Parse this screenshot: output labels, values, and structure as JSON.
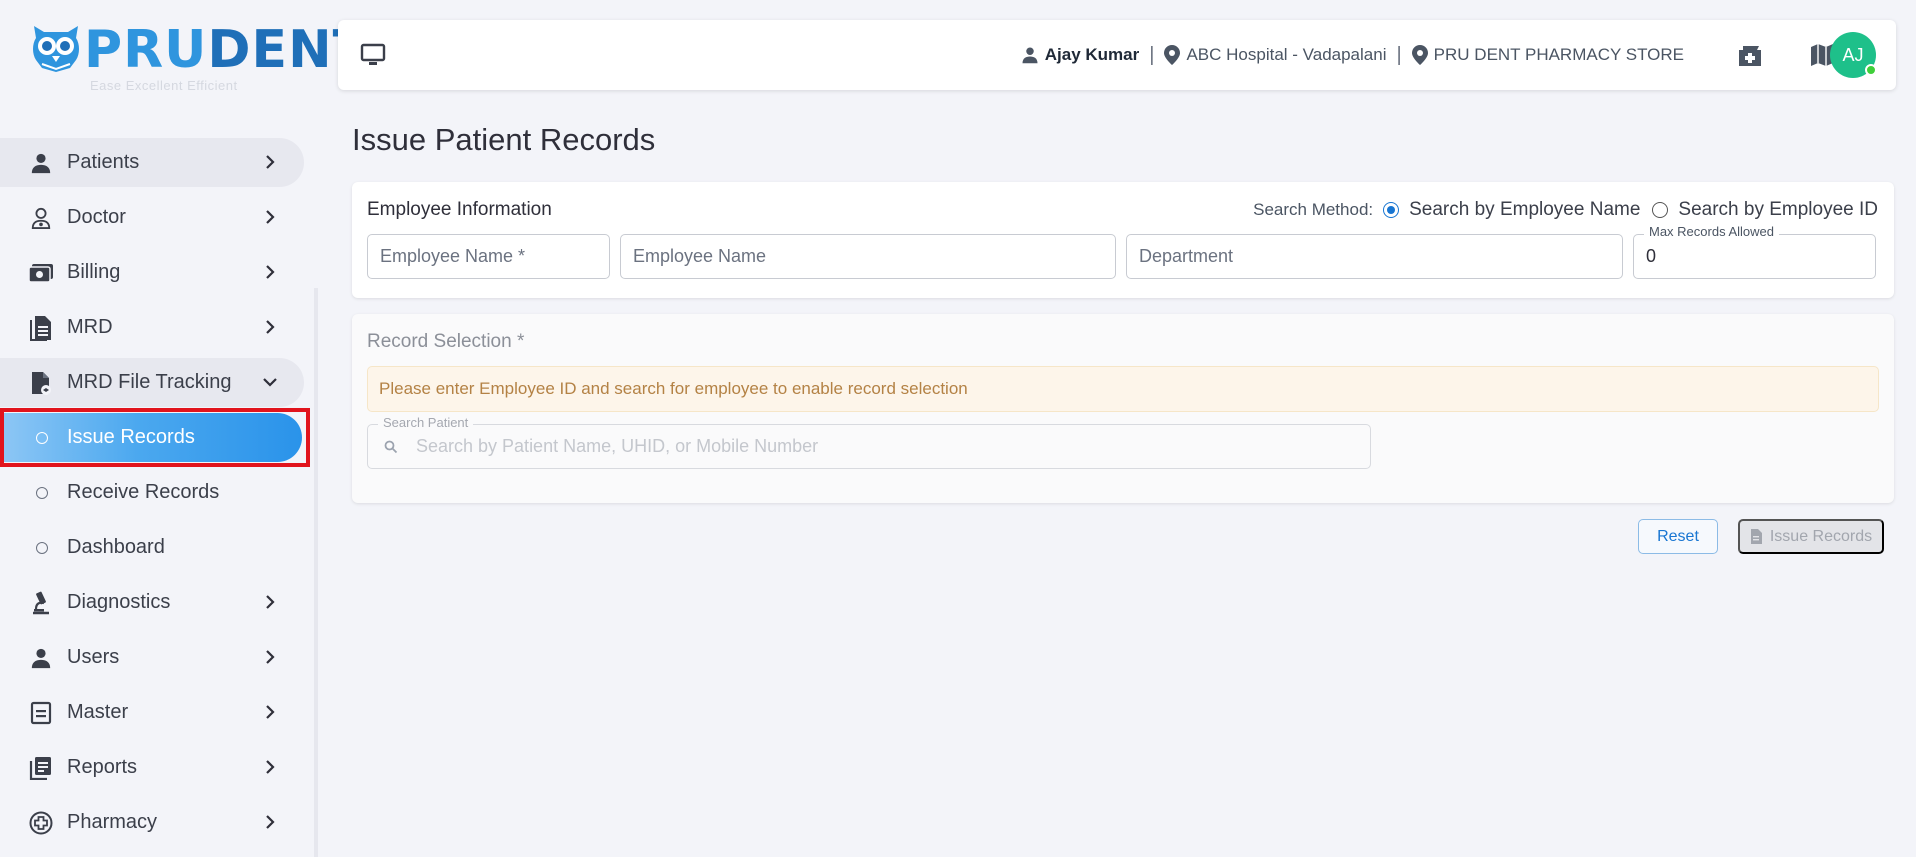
{
  "brand": {
    "name_part1": "PRU",
    "name_part2": "DENT",
    "tagline": "Ease Excellent Efficient"
  },
  "sidebar": {
    "items": [
      {
        "label": "Patients",
        "icon": "person-icon"
      },
      {
        "label": "Doctor",
        "icon": "doctor-icon"
      },
      {
        "label": "Billing",
        "icon": "billing-icon"
      },
      {
        "label": "MRD",
        "icon": "document-icon"
      },
      {
        "label": "MRD File Tracking",
        "icon": "file-tracking-icon",
        "expanded": true,
        "children": [
          {
            "label": "Issue Records",
            "active": true
          },
          {
            "label": "Receive Records"
          },
          {
            "label": "Dashboard"
          }
        ]
      },
      {
        "label": "Diagnostics",
        "icon": "microscope-icon"
      },
      {
        "label": "Users",
        "icon": "person-icon"
      },
      {
        "label": "Master",
        "icon": "master-icon"
      },
      {
        "label": "Reports",
        "icon": "reports-icon"
      },
      {
        "label": "Pharmacy",
        "icon": "pharmacy-icon"
      }
    ]
  },
  "topbar": {
    "user": "Ajay Kumar",
    "location": "ABC Hospital - Vadapalani",
    "store": "PRU DENT PHARMACY STORE",
    "avatar_initials": "AJ",
    "avatar_color": "#1ec08a"
  },
  "page": {
    "title": "Issue Patient Records"
  },
  "employee": {
    "title": "Employee Information",
    "search_method_label": "Search Method:",
    "option_name": "Search by Employee Name",
    "option_id": "Search by Employee ID",
    "selected_option": "Search by Employee Name",
    "emp_name_required_placeholder": "Employee Name *",
    "emp_name_placeholder": "Employee Name",
    "department_placeholder": "Department",
    "max_records_label": "Max Records Allowed",
    "max_records_value": "0"
  },
  "records": {
    "title": "Record Selection *",
    "alert": "Please enter Employee ID and search for employee to enable record selection",
    "search_label": "Search Patient",
    "search_placeholder": "Search by Patient Name, UHID, or Mobile Number"
  },
  "actions": {
    "reset": "Reset",
    "issue": "Issue Records"
  },
  "colors": {
    "accent": "#1976d2",
    "active_gradient_end": "#2a93ea",
    "alert_bg": "#fdf5ea",
    "alert_text": "#b48245"
  }
}
